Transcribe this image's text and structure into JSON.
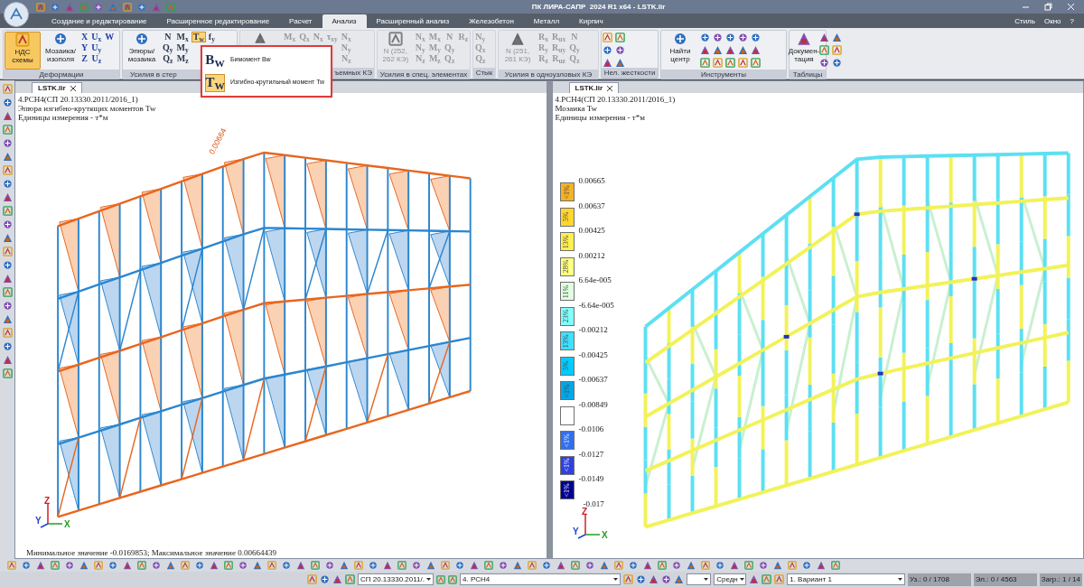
{
  "window": {
    "title": "ПК ЛИРА-САПР  2024 R1 x64 - LSTK.lir"
  },
  "ribbon_tabs": [
    {
      "label": "Создание и редактирование",
      "selected": false
    },
    {
      "label": "Расширенное редактирование",
      "selected": false
    },
    {
      "label": "Расчет",
      "selected": false
    },
    {
      "label": "Анализ",
      "selected": true
    },
    {
      "label": "Расширенный анализ",
      "selected": false
    },
    {
      "label": "Железобетон",
      "selected": false
    },
    {
      "label": "Металл",
      "selected": false
    },
    {
      "label": "Кирпич",
      "selected": false
    }
  ],
  "menu_right": [
    "Стиль",
    "Окно",
    "?"
  ],
  "ribbon_groups": [
    {
      "label": "Деформации",
      "disabled": false,
      "large_buttons": [
        {
          "label": "НДС схемы",
          "selected": true
        },
        {
          "label": "Мозаика/ изополя",
          "selected": false
        }
      ],
      "button_columns": [
        [
          {
            "label": "X",
            "selected": false
          },
          {
            "label": "Y",
            "selected": false
          },
          {
            "label": "Z",
            "selected": false
          }
        ],
        [
          {
            "label": "U$_{x}$",
            "selected": false
          },
          {
            "label": "U$_{y}$",
            "selected": false
          },
          {
            "label": "U$_{z}$",
            "selected": false
          }
        ],
        [
          {
            "label": "W",
            "selected": false
          }
        ]
      ]
    },
    {
      "label": "Усилия в стер",
      "disabled": false,
      "large_buttons": [
        {
          "label": "Эпюры/ мозаика",
          "selected": false
        }
      ],
      "button_columns": [
        [
          {
            "label": "N",
            "selected": false
          },
          {
            "label": "Q$_{y}$",
            "selected": false
          },
          {
            "label": "Q$_{z}$",
            "selected": false
          }
        ],
        [
          {
            "label": "M$_{x}$",
            "selected": false
          },
          {
            "label": "M$_{y}$",
            "selected": false
          },
          {
            "label": "M$_{z}$",
            "selected": false
          }
        ],
        [
          {
            "label": "T$_{w}$",
            "selected": true
          }
        ],
        [
          {
            "label": "f$_{y}$",
            "selected": false
          }
        ]
      ]
    },
    {
      "label": "ъемных КЭ",
      "disabled": true,
      "button_columns": [
        [
          {
            "label": "M$_{x}$",
            "selected": false
          }
        ],
        [
          {
            "label": "Q$_{x}$",
            "selected": false
          }
        ],
        [
          {
            "label": "N$_{x}$",
            "selected": false
          }
        ],
        [
          {
            "label": "τ$_{xy}$",
            "selected": false
          }
        ],
        [
          {
            "label": "N$_{x}$",
            "selected": false
          },
          {
            "label": "N$_{y}$",
            "selected": false
          },
          {
            "label": "N$_{z}$",
            "selected": false
          }
        ]
      ]
    },
    {
      "label": "Усилия в спец. элементах",
      "disabled": true,
      "large_buttons": [
        {
          "label": "N (252, 262 КЭ)",
          "selected": false
        }
      ],
      "button_columns": [
        [
          {
            "label": "N$_{x}$",
            "selected": false
          },
          {
            "label": "N$_{y}$",
            "selected": false
          },
          {
            "label": "N$_{z}$",
            "selected": false
          }
        ],
        [
          {
            "label": "M$_{x}$",
            "selected": false
          },
          {
            "label": "M$_{y}$",
            "selected": false
          },
          {
            "label": "M$_{z}$",
            "selected": false
          }
        ],
        [
          {
            "label": "N",
            "selected": false
          },
          {
            "label": "Q$_{y}$",
            "selected": false
          },
          {
            "label": "Q$_{z}$",
            "selected": false
          }
        ],
        [
          {
            "label": "R$_{z}$",
            "selected": false
          }
        ]
      ]
    },
    {
      "label": "Стык",
      "disabled": true,
      "button_columns": [
        [
          {
            "label": "N$_{y}$",
            "selected": false
          },
          {
            "label": "Q$_{x}$",
            "selected": false
          },
          {
            "label": "Q$_{z}$",
            "selected": false
          }
        ]
      ]
    },
    {
      "label": "Усилия в одноузловых КЭ",
      "disabled": true,
      "large_buttons": [
        {
          "label": "N (251, 261 КЭ)",
          "selected": false
        }
      ],
      "button_columns": [
        [
          {
            "label": "R$_{x}$",
            "selected": false
          },
          {
            "label": "R$_{y}$",
            "selected": false
          },
          {
            "label": "R$_{z}$",
            "selected": false
          }
        ],
        [
          {
            "label": "R$_{ux}$",
            "selected": false
          },
          {
            "label": "R$_{uy}$",
            "selected": false
          },
          {
            "label": "R$_{uz}$",
            "selected": false
          }
        ],
        [
          {
            "label": "N",
            "selected": false
          },
          {
            "label": "Q$_{y}$",
            "selected": false
          },
          {
            "label": "Q$_{z}$",
            "selected": false
          }
        ]
      ]
    },
    {
      "label": "Нел. жесткости",
      "disabled": false
    },
    {
      "label": "Инструменты",
      "disabled": false,
      "large_buttons": [
        {
          "label": "Найти центр",
          "selected": false
        }
      ]
    },
    {
      "label": "Таблицы",
      "disabled": false,
      "large_buttons": [
        {
          "label": "Докумен- тация",
          "selected": false
        }
      ]
    }
  ],
  "dropdown_menu": [
    {
      "icon": "B$_{W}$",
      "label": "Бимомент Bw",
      "selected": false
    },
    {
      "icon": "T$_{W}$",
      "label": "Изгибно-крутильный момент Tw",
      "selected": true
    }
  ],
  "panes": [
    {
      "kind": "diagram",
      "tab": "LSTK.lir",
      "lines": [
        "4.РСН4(СП 20.13330.2011/2016_1)",
        "Эпюра изгибно-крутящих моментов Tw",
        "Единицы измерения - т*м"
      ],
      "annotation": "0.00664",
      "axes": {
        "x": "X",
        "y": "Y",
        "z": "Z"
      },
      "footer": "Минимальное значение  -0.0169853; Максимальное значение  0.00664439"
    },
    {
      "kind": "mosaic",
      "tab": "LSTK.lir",
      "lines": [
        "4.РСН4(СП 20.13330.2011/2016_1)",
        "Мозаика  Tw",
        "Единицы измерения - т*м"
      ],
      "axes": {
        "x": "X",
        "y": "Y",
        "z": "Z"
      },
      "legend": {
        "values": [
          "0.00665",
          "0.00637",
          "0.00425",
          "0.00212",
          "6.64e-005",
          "-6.64e-005",
          "-0.00212",
          "-0.00425",
          "-0.00637",
          "-0.00849",
          "-0.0106",
          "-0.0127",
          "-0.0149",
          "-0.017"
        ],
        "entries": [
          {
            "color": "#f5b324",
            "share": "<1%"
          },
          {
            "color": "#ffd72e",
            "share": "5%"
          },
          {
            "color": "#fff04d",
            "share": "13%"
          },
          {
            "color": "#ffff80",
            "share": "28%"
          },
          {
            "color": "#e0ffe0",
            "share": "11%"
          },
          {
            "color": "#80ffff",
            "share": "23%"
          },
          {
            "color": "#40e0ff",
            "share": "13%"
          },
          {
            "color": "#00ccff",
            "share": "5%"
          },
          {
            "color": "#00a8e8",
            "share": "<1%"
          },
          {
            "color": "#ffffff"
          },
          {
            "color": "#3070f0",
            "share": "<1%"
          },
          {
            "color": "#3040e0",
            "share": "<1%"
          },
          {
            "color": "#000090",
            "share": "<1%"
          }
        ]
      }
    }
  ],
  "status_bar": {
    "norm_combo": "СП 20.13330.2011/.",
    "load_combo": "4. РСН4",
    "mode_combo": "Средн",
    "variant_combo": "1. Вариант 1",
    "nodes": "Уз.: 0 / 1708",
    "elements": "Эл.: 0 / 4563",
    "loads": "Загр.: 1 / 14"
  }
}
